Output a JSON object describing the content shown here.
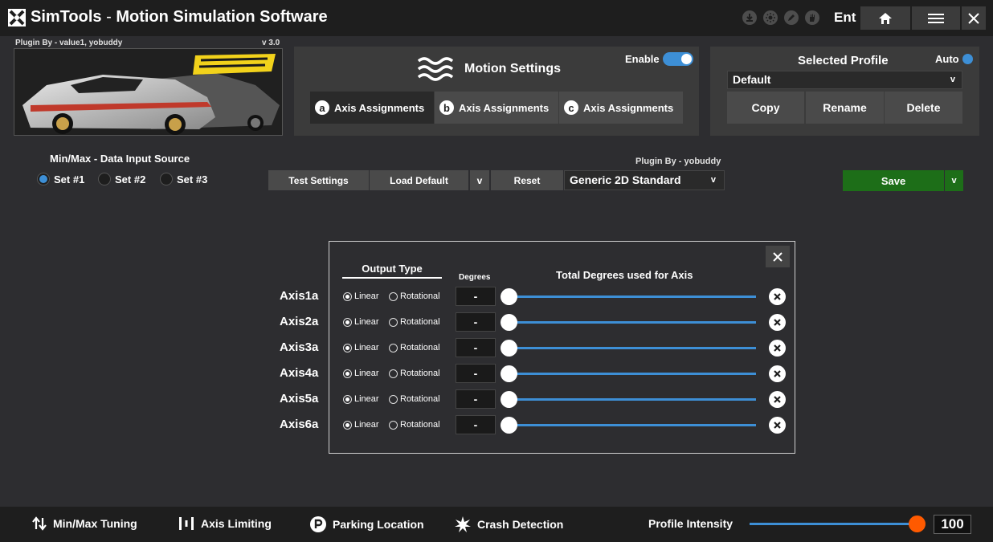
{
  "titlebar": {
    "app_name": "SimTools",
    "separator": " - ",
    "subtitle": "Motion Simulation Software",
    "ent_label": "Ent",
    "icons": [
      "download-icon",
      "sun-icon",
      "pencil-icon",
      "hand-icon"
    ],
    "home_icon": "home-icon",
    "menu_icon": "hamburger-icon",
    "close_icon": "close-icon"
  },
  "plugin": {
    "by_top": "Plugin By - value1, yobuddy",
    "version": "v 3.0",
    "by_mid": "Plugin By - yobuddy",
    "selected": "Generic 2D Standard"
  },
  "motion": {
    "title": "Motion Settings",
    "enable_label": "Enable",
    "enabled": true,
    "tabs": [
      {
        "letter": "a",
        "label": "Axis Assignments"
      },
      {
        "letter": "b",
        "label": "Axis Assignments"
      },
      {
        "letter": "c",
        "label": "Axis Assignments"
      }
    ]
  },
  "profile": {
    "title": "Selected Profile",
    "auto_label": "Auto",
    "selected": "Default",
    "buttons": {
      "copy": "Copy",
      "rename": "Rename",
      "delete": "Delete"
    }
  },
  "data_input": {
    "title": "Min/Max - Data Input Source",
    "sets": [
      {
        "label": "Set #1",
        "selected": true
      },
      {
        "label": "Set #2",
        "selected": false
      },
      {
        "label": "Set #3",
        "selected": false
      }
    ]
  },
  "toolbar": {
    "test_settings": "Test Settings",
    "load_default": "Load Default",
    "drop": "v",
    "reset": "Reset",
    "save": "Save",
    "save_drop": "v"
  },
  "axis_dialog": {
    "output_type_label": "Output Type",
    "degrees_label": "Degrees",
    "total_label": "Total Degrees used for Axis",
    "axes": [
      {
        "label": "Axis1a",
        "linear": "Linear",
        "rotational": "Rotational",
        "output": "linear",
        "degrees": "-"
      },
      {
        "label": "Axis2a",
        "linear": "Linear",
        "rotational": "Rotational",
        "output": "linear",
        "degrees": "-"
      },
      {
        "label": "Axis3a",
        "linear": "Linear",
        "rotational": "Rotational",
        "output": "linear",
        "degrees": "-"
      },
      {
        "label": "Axis4a",
        "linear": "Linear",
        "rotational": "Rotational",
        "output": "linear",
        "degrees": "-"
      },
      {
        "label": "Axis5a",
        "linear": "Linear",
        "rotational": "Rotational",
        "output": "linear",
        "degrees": "-"
      },
      {
        "label": "Axis6a",
        "linear": "Linear",
        "rotational": "Rotational",
        "output": "linear",
        "degrees": "-"
      }
    ]
  },
  "bottombar": {
    "items": [
      {
        "label": "Min/Max Tuning",
        "icon": "updown-arrows-icon"
      },
      {
        "label": "Axis Limiting",
        "icon": "bars-icon"
      },
      {
        "label": "Parking Location",
        "icon": "parking-icon"
      },
      {
        "label": "Crash Detection",
        "icon": "burst-icon"
      }
    ],
    "intensity_label": "Profile Intensity",
    "intensity_value": "100"
  },
  "colors": {
    "accent": "#3d8fd6",
    "save_green": "#1d6e18",
    "intensity_knob": "#ff5a00",
    "titlebar": "#1e1e1e",
    "background": "#2d2d30"
  }
}
